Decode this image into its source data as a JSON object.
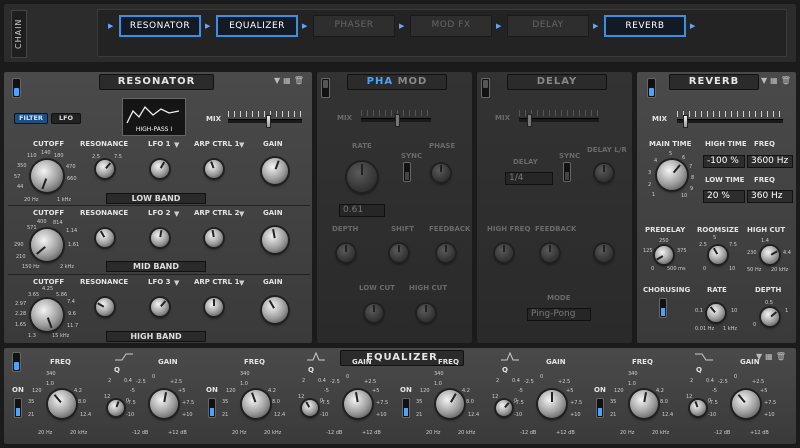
{
  "chain": {
    "label": "CHAIN",
    "modules": [
      {
        "label": "RESONATOR",
        "active": true
      },
      {
        "label": "EQUALIZER",
        "active": true
      },
      {
        "label": "PHASER",
        "active": false
      },
      {
        "label": "MOD FX",
        "active": false
      },
      {
        "label": "DELAY",
        "active": false
      },
      {
        "label": "REVERB",
        "active": true
      }
    ]
  },
  "resonator": {
    "title": "RESONATOR",
    "filter_tab": "FILTER",
    "lfo_tab": "LFO",
    "filter_display": "HIGH-PASS I",
    "mix_label": "MIX",
    "cutoff_label": "CUTOFF",
    "resonance_label": "RESONANCE",
    "gain_label": "GAIN",
    "bands": [
      {
        "name": "LOW BAND",
        "lfo": "LFO 1",
        "arp": "ARP CTRL 1",
        "cutoff_ticks": [
          "110",
          "140",
          "180",
          "44",
          "57",
          "20 Hz",
          "1 kHz",
          "470",
          "660",
          "350"
        ],
        "res_ticks": [
          "2.5",
          "5",
          "7.5",
          "10",
          "0",
          "10"
        ],
        "gain_ticks": [
          "2",
          "4",
          "6",
          "8",
          "0",
          "10"
        ],
        "mod_ticks": [
          "-5",
          "0",
          "5",
          "-10",
          "10"
        ]
      },
      {
        "name": "MID BAND",
        "lfo": "LFO 2",
        "arp": "ARP CTRL 2",
        "cutoff_ticks": [
          "400",
          "571",
          "814",
          "290",
          "210",
          "150 Hz",
          "2 kHz",
          "1.14",
          "1.61"
        ],
        "res_ticks": [
          "2.5",
          "5",
          "7.5",
          "10",
          "0",
          "10"
        ],
        "gain_ticks": [
          "2",
          "4",
          "6",
          "8",
          "0",
          "10"
        ],
        "mod_ticks": [
          "-5",
          "0",
          "5",
          "-10",
          "10"
        ]
      },
      {
        "name": "HIGH BAND",
        "lfo": "LFO 3",
        "arp": "ARP CTRL 1",
        "cutoff_ticks": [
          "4.25",
          "3.65",
          "5.86",
          "2.97",
          "2.28",
          "1.65",
          "1.3",
          "15 kHz",
          "7.4",
          "9.6",
          "11.7"
        ],
        "res_ticks": [
          "2.5",
          "5",
          "7.5",
          "10",
          "0",
          "10"
        ],
        "gain_ticks": [
          "2",
          "4",
          "6",
          "8",
          "0",
          "10"
        ],
        "mod_ticks": [
          "-5",
          "0",
          "5",
          "-10",
          "10"
        ]
      }
    ]
  },
  "phamod": {
    "title_a": "PHA",
    "title_b": "MOD",
    "mix": "MIX",
    "rate": "RATE",
    "sync": "SYNC",
    "phase": "PHASE",
    "value": "0.61",
    "depth": "DEPTH",
    "shift": "SHIFT",
    "feedback": "FEEDBACK",
    "low_cut": "LOW CUT",
    "high_cut": "HIGH CUT"
  },
  "delay": {
    "title": "DELAY",
    "mix": "MIX",
    "delay": "DELAY",
    "sync": "SYNC",
    "delay_lr": "DELAY L/R",
    "division": "1/4",
    "high_freq": "HIGH FREQ",
    "feedback": "FEEDBACK",
    "mode": "MODE",
    "mode_value": "Ping-Pong"
  },
  "reverb": {
    "title": "REVERB",
    "mix": "MIX",
    "main_time": "MAIN TIME",
    "high_time": "HIGH TIME",
    "freq": "FREQ",
    "low_time": "LOW TIME",
    "high_time_val": "-100 %",
    "high_freq_val": "3600 Hz",
    "low_time_val": "20 %",
    "low_freq_val": "360 Hz",
    "predelay": "PREDELAY",
    "roomsize": "ROOMSIZE",
    "high_cut": "HIGH CUT",
    "chorusing": "CHORUSING",
    "rate": "RATE",
    "depth": "DEPTH",
    "main_ticks": [
      "1",
      "2",
      "3",
      "4",
      "5",
      "6",
      "7",
      "8",
      "9",
      "10"
    ],
    "predelay_ticks": [
      "125",
      "250",
      "375",
      "0",
      "500 ms"
    ],
    "room_ticks": [
      "2.5",
      "5",
      "7.5",
      "0",
      "10"
    ],
    "hc_ticks": [
      "230",
      "1.4",
      "4.4",
      "50 Hz",
      "20 kHz"
    ],
    "rate_ticks": [
      "0.1",
      "10",
      "0.01 Hz",
      "1 kHz"
    ],
    "depth_ticks": [
      "0.5",
      "1",
      "0"
    ]
  },
  "equalizer": {
    "title": "EQUALIZER",
    "on": "ON",
    "freq": "FREQ",
    "q": "Q",
    "gain": "GAIN",
    "freq_ticks": [
      "340",
      "1.0",
      "120",
      "4.2",
      "35",
      "8.0",
      "21",
      "12.4",
      "20 Hz",
      "20 kHz"
    ],
    "q_ticks": [
      "2",
      "0.4",
      "12",
      "0"
    ],
    "gain_ticks": [
      "-2.5",
      "0",
      "+2.5",
      "-5",
      "+5",
      "-7.5",
      "+7.5",
      "-10",
      "+10",
      "-12 dB",
      "+12 dB"
    ]
  }
}
